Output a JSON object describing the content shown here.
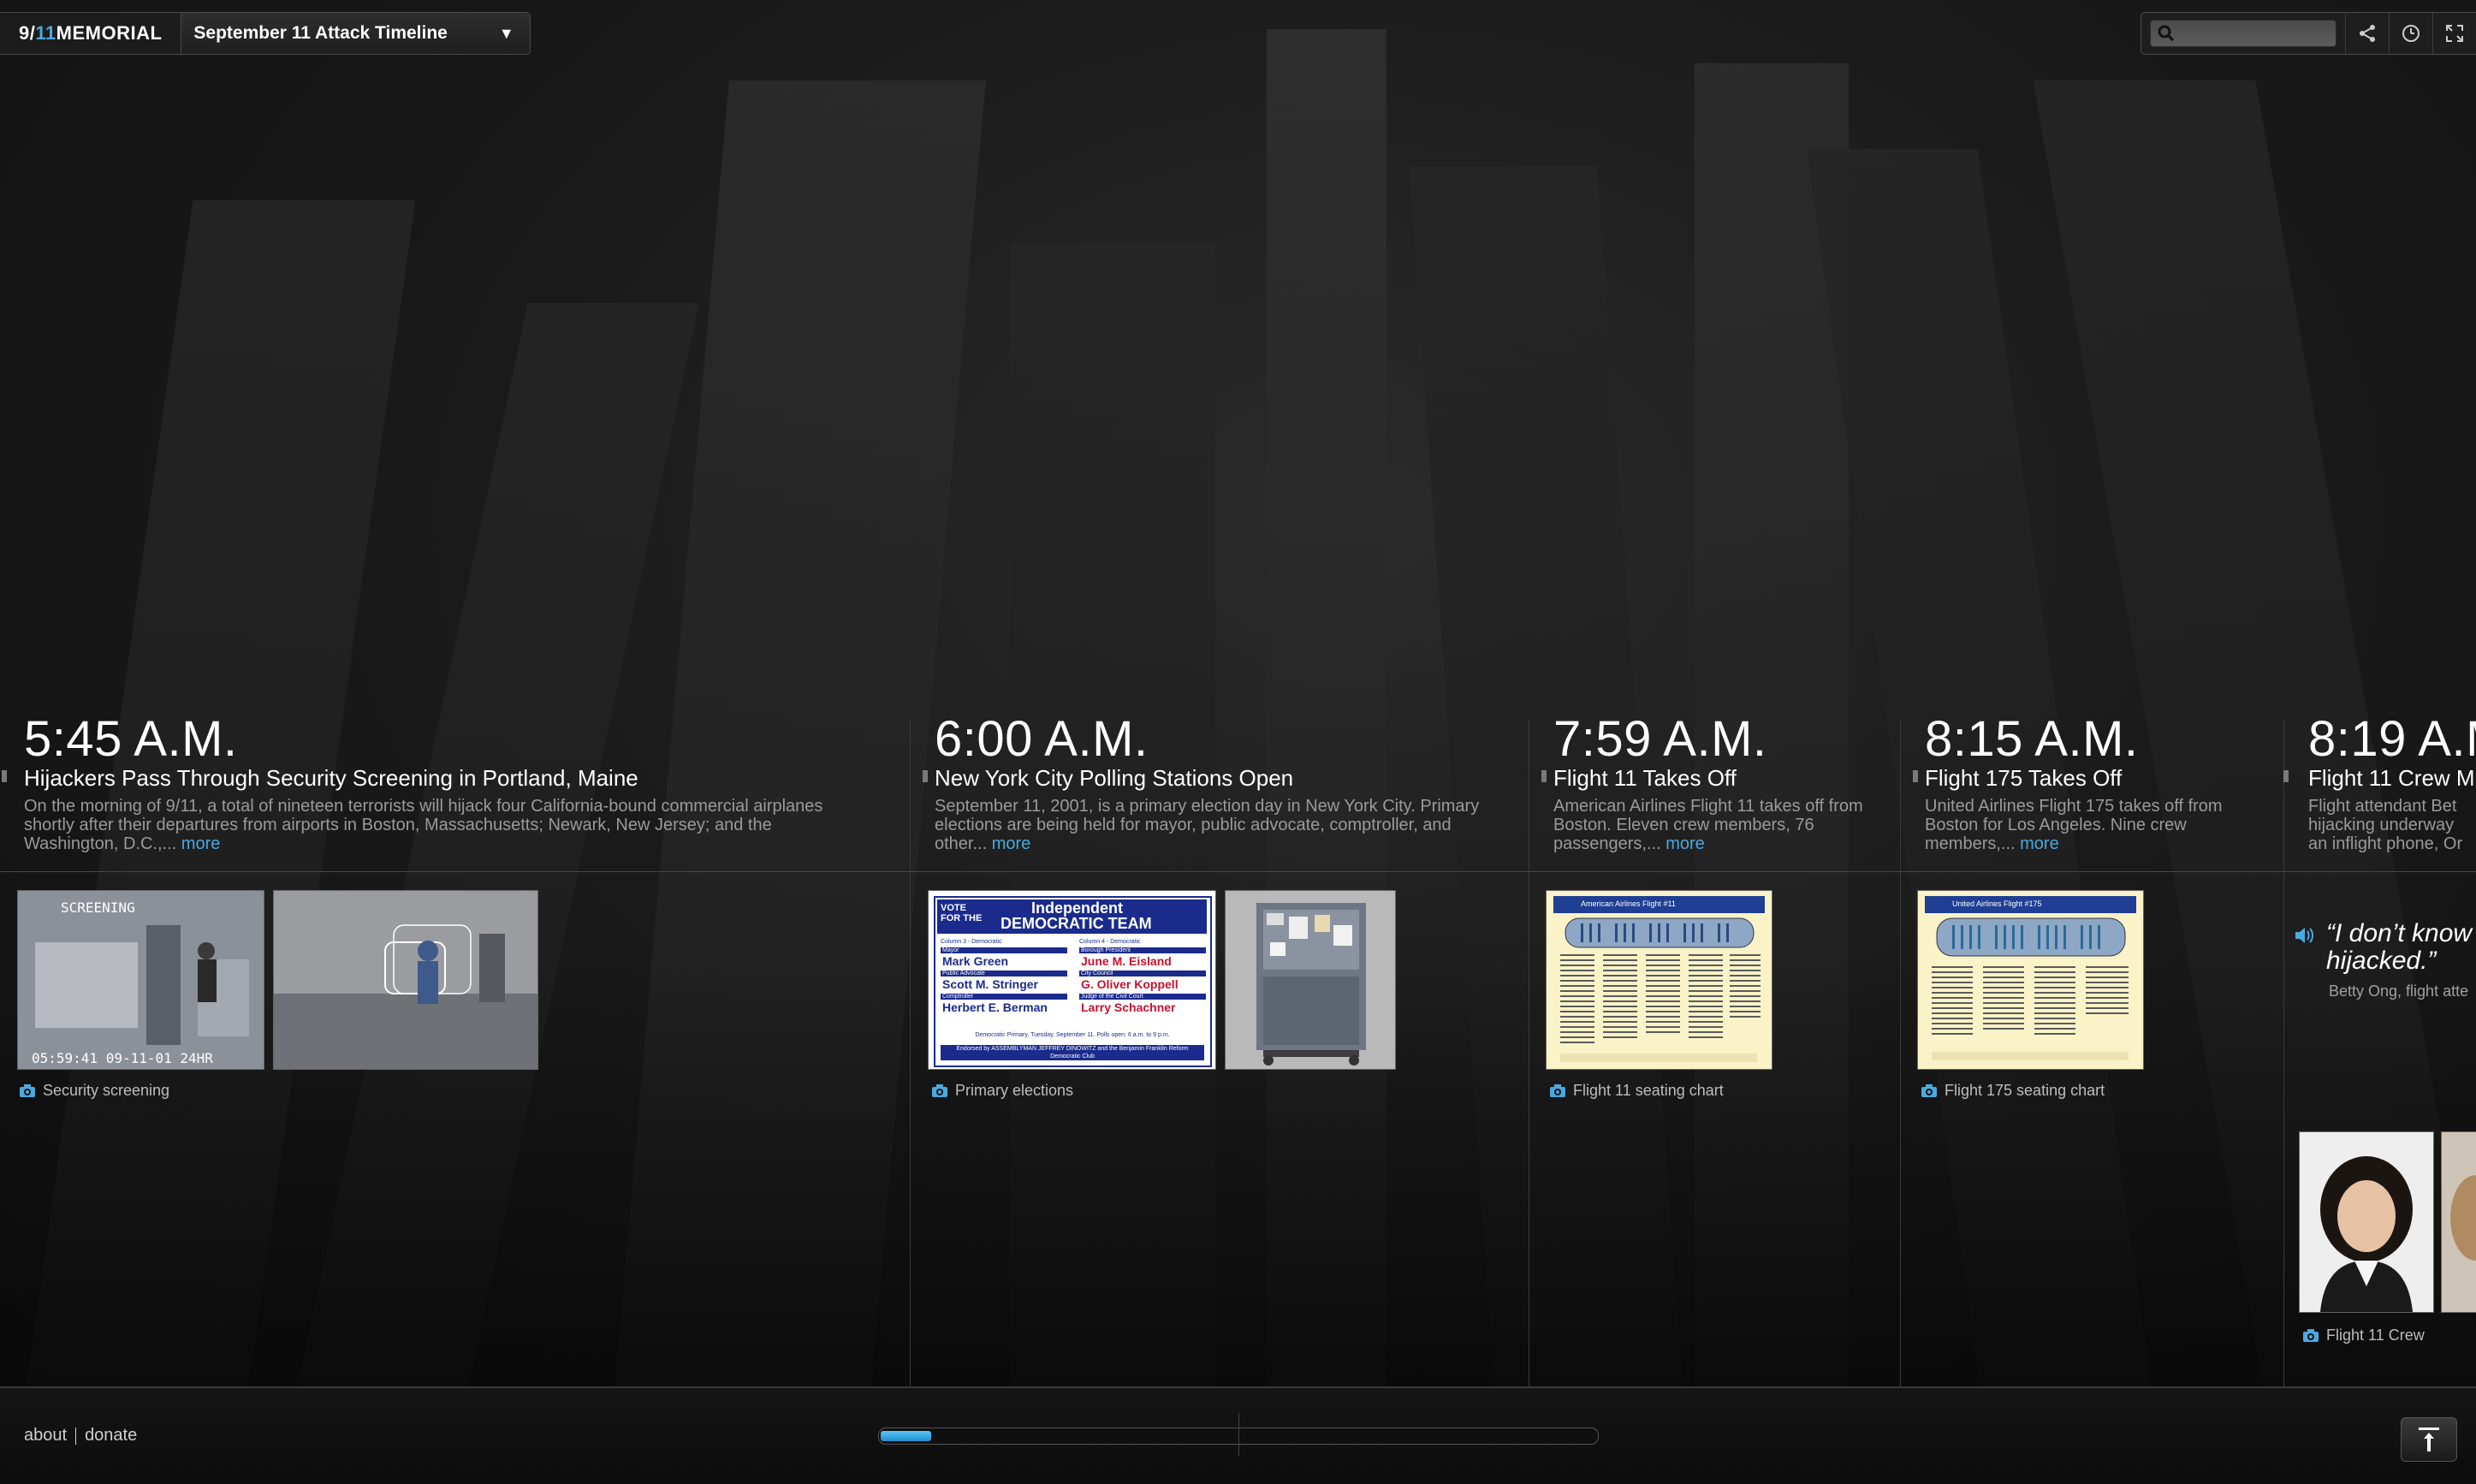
{
  "header": {
    "brand_prefix": "9/",
    "brand_accent": "11",
    "brand_suffix": " MEMORIAL",
    "timeline_selector": "September 11 Attack Timeline",
    "search_placeholder": ""
  },
  "icons": {
    "search": "magnifier-icon",
    "share": "share-icon",
    "history": "clock-icon",
    "fullscreen": "fullscreen-icon",
    "camera": "camera-icon",
    "audio": "speaker-icon"
  },
  "colors": {
    "accent": "#4aa9e0",
    "background": "#121212"
  },
  "events": [
    {
      "time": "5:45 A.M.",
      "title": "Hijackers Pass Through Security Screening in Portland, Maine",
      "desc": "On the morning of 9/11, a total of nineteen terrorists will hijack four California-bound commercial airplanes shortly after their departures from airports in Boston, Massachusetts; Newark, New Jersey; and the Washington, D.C.,...",
      "more": "more",
      "caption": "Security screening",
      "cctv_timestamp": "05:59:41 09-11-01 24HR",
      "cctv_label": "SCREENING"
    },
    {
      "time": "6:00 A.M.",
      "title": "New York City Polling Stations Open",
      "desc": "September 11, 2001, is a primary election day in New York City. Primary elections are being held for mayor, public advocate, comptroller, and other...",
      "more": "more",
      "caption": "Primary elections",
      "ballot": {
        "vote_for_the": "VOTE FOR THE",
        "heading_1": "Independent",
        "heading_2": "DEMOCRATIC TEAM",
        "col3_header": "Column 3 - Democratic",
        "col4_header": "Column 4 - Democratic",
        "left": [
          {
            "office": "Mayor",
            "name": "Mark Green"
          },
          {
            "office": "Public Advocate",
            "name": "Scott M. Stringer"
          },
          {
            "office": "Comptroller",
            "name": "Herbert E. Berman"
          }
        ],
        "right": [
          {
            "office": "Borough President",
            "name": "June M. Eisland"
          },
          {
            "office": "City Council",
            "name": "G. Oliver Koppell"
          },
          {
            "office": "Judge of the Civil Court",
            "name": "Larry Schachner"
          }
        ],
        "footer_1": "Democratic Primary, Tuesday, September 11. Polls open: 6 a.m. to 9 p.m.",
        "footer_2": "Endorsed by ASSEMBLYMAN JEFFREY DINOWITZ and the Benjamin Franklin Reform Democratic Club"
      }
    },
    {
      "time": "7:59 A.M.",
      "title": "Flight 11 Takes Off",
      "desc": "American Airlines Flight 11 takes off from Boston. Eleven crew members, 76 passengers,...",
      "more": "more",
      "caption": "Flight 11 seating chart",
      "chart_title": "American Airlines Flight #11"
    },
    {
      "time": "8:15 A.M.",
      "title": "Flight 175 Takes Off",
      "desc": "United Airlines Flight 175 takes off from Boston for Los Angeles. Nine crew members,...",
      "more": "more",
      "caption": "Flight 175 seating chart",
      "chart_title": "United Airlines Flight #175"
    },
    {
      "time": "8:19 A.M",
      "title": "Flight 11 Crew M",
      "desc": "Flight attendant Bet hijacking underway an inflight phone, Or",
      "quote_1": "“I don’t know",
      "quote_2": "hijacked.”",
      "quote_by": "Betty Ong, flight atte",
      "caption": "Flight 11 Crew"
    }
  ],
  "footer": {
    "about": "about",
    "donate": "donate",
    "progress": 0.07
  }
}
